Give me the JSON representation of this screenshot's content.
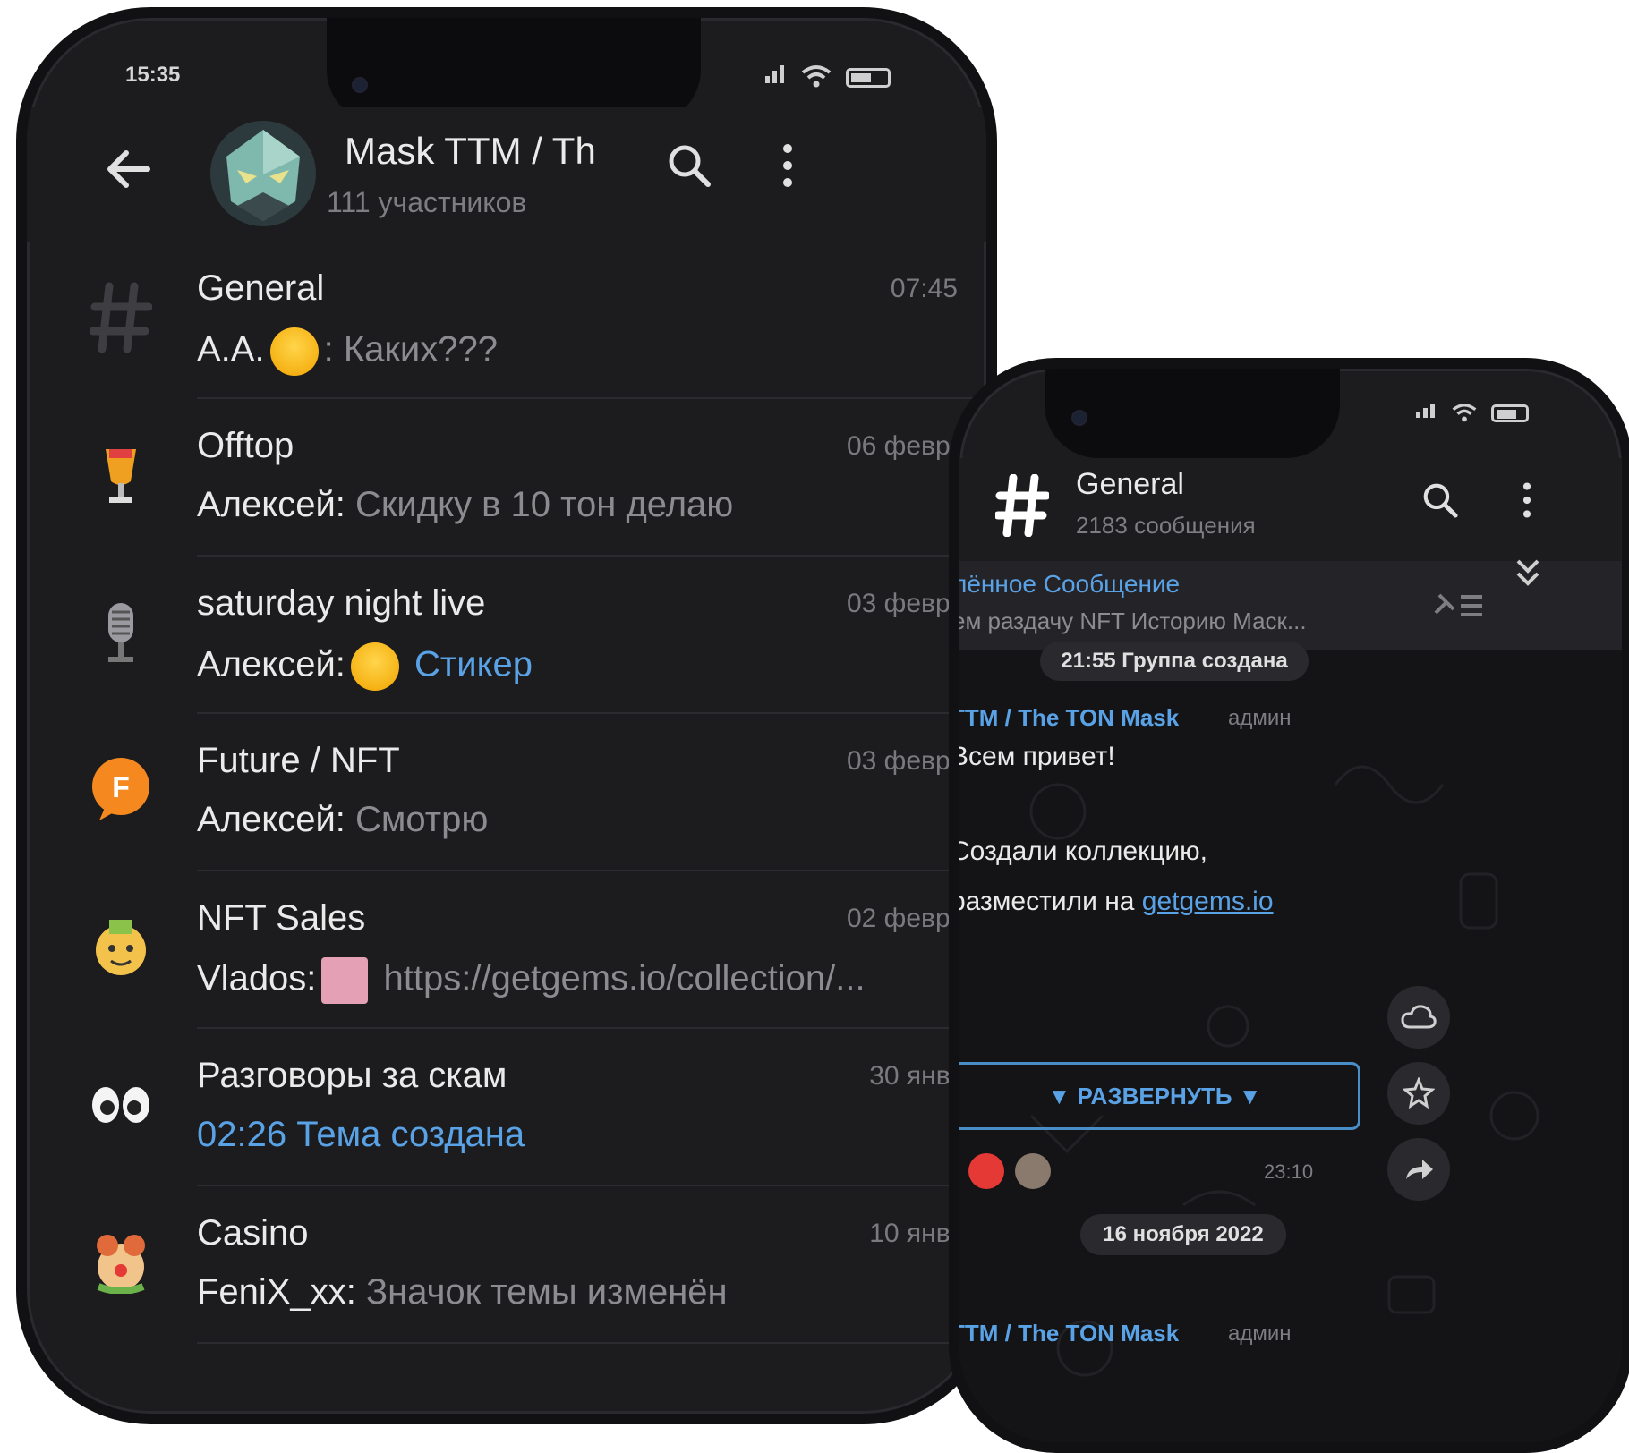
{
  "left_phone": {
    "status_time": "15:35",
    "header": {
      "title": "Mask TTM / Th",
      "subtitle": "111 участников"
    },
    "topics": [
      {
        "icon": "hashtag-icon",
        "title": "General",
        "date": "07:45",
        "sender": "А.А.",
        "preview": ": Каких???",
        "preview_style": "gray"
      },
      {
        "icon": "cocktail-icon",
        "title": "Offtop",
        "date": "06 февр.",
        "sender": "Алексей:",
        "preview": " Скидку в 10 тон делаю",
        "preview_style": "gray"
      },
      {
        "icon": "microphone-icon",
        "title": "saturday night live",
        "date": "03 февр.",
        "sender": "Алексей:",
        "preview": " Стикер",
        "preview_style": "blue"
      },
      {
        "icon": "speech-bubble-f-icon",
        "title": "Future / NFT",
        "date": "03 февр.",
        "sender": "Алексей:",
        "preview": " Смотрю",
        "preview_style": "gray"
      },
      {
        "icon": "money-face-icon",
        "title": "NFT Sales",
        "date": "02 февр.",
        "sender": "Vlados:",
        "preview": " https://getgems.io/collection/...",
        "preview_style": "gray"
      },
      {
        "icon": "eyes-icon",
        "title": "Разговоры за скам",
        "date": "30 янв.",
        "sender": "",
        "preview": "02:26 Тема создана",
        "preview_style": "blue"
      },
      {
        "icon": "clown-icon",
        "title": "Casino",
        "date": "10 янв.",
        "sender": "FeniX_xx:",
        "preview": " Значок темы изменён",
        "preview_style": "gray"
      }
    ]
  },
  "right_phone": {
    "header": {
      "title": "General",
      "subtitle": "2183 сообщения"
    },
    "pinned": {
      "title": "лённое Сообщение",
      "text": "ем раздачу NFT  Историю Маск..."
    },
    "service_created": "21:55 Группа создана",
    "message": {
      "author": "TTM / The TON Mask",
      "role": "админ",
      "line1": "Всем привет!",
      "line2": "Создали коллекцию,",
      "line3_prefix": "разместили на ",
      "link": "getgems.io",
      "expand_button": "▼ РАЗВЕРНУТЬ ▼",
      "time": "23:10"
    },
    "date_chip": "16 ноября 2022",
    "next_author": "TTM / The TON Mask",
    "next_role": "админ"
  },
  "colors": {
    "background": "#1c1c1e",
    "accent_blue": "#5aa2e6",
    "header": "#242428"
  }
}
